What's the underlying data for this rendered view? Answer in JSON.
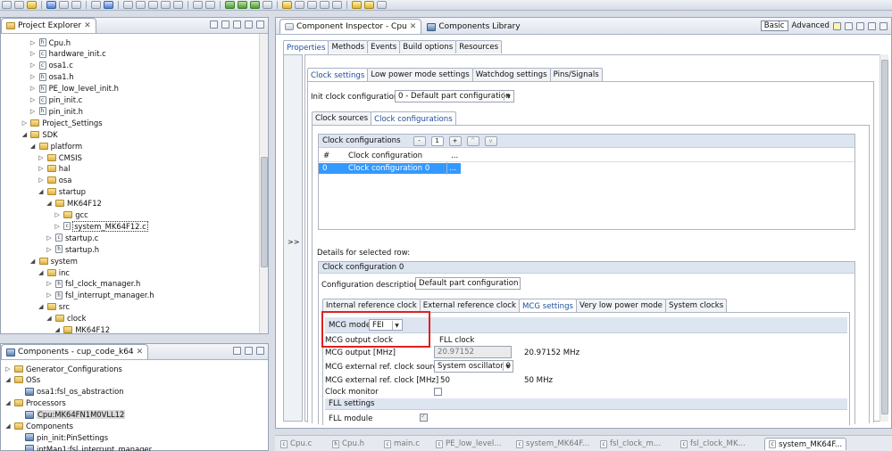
{
  "project_explorer": {
    "title": "Project Explorer",
    "close": "✕",
    "items": [
      {
        "label": "Cpu.h",
        "icon": "h"
      },
      {
        "label": "hardware_init.c",
        "icon": "c"
      },
      {
        "label": "osa1.c",
        "icon": "c"
      },
      {
        "label": "osa1.h",
        "icon": "h"
      },
      {
        "label": "PE_low_level_init.h",
        "icon": "h"
      },
      {
        "label": "pin_init.c",
        "icon": "c"
      },
      {
        "label": "pin_init.h",
        "icon": "h"
      },
      {
        "label": "Project_Settings",
        "icon": "folder"
      },
      {
        "label": "SDK",
        "icon": "folder"
      },
      {
        "label": "platform",
        "icon": "folder"
      },
      {
        "label": "CMSIS",
        "icon": "folder"
      },
      {
        "label": "hal",
        "icon": "folder"
      },
      {
        "label": "osa",
        "icon": "folder"
      },
      {
        "label": "startup",
        "icon": "folder"
      },
      {
        "label": "MK64F12",
        "icon": "folder"
      },
      {
        "label": "gcc",
        "icon": "folder"
      },
      {
        "label": "system_MK64F12.c",
        "icon": "c"
      },
      {
        "label": "startup.c",
        "icon": "c"
      },
      {
        "label": "startup.h",
        "icon": "h"
      },
      {
        "label": "system",
        "icon": "folder"
      },
      {
        "label": "inc",
        "icon": "folder"
      },
      {
        "label": "fsl_clock_manager.h",
        "icon": "h"
      },
      {
        "label": "fsl_interrupt_manager.h",
        "icon": "h"
      },
      {
        "label": "src",
        "icon": "folder"
      },
      {
        "label": "clock",
        "icon": "folder"
      },
      {
        "label": "MK64F12",
        "icon": "folder"
      }
    ]
  },
  "components_view": {
    "title": "Components - cup_code_k64",
    "close": "✕",
    "items": [
      {
        "label": "Generator_Configurations"
      },
      {
        "label": "OSs"
      },
      {
        "label": "osa1:fsl_os_abstraction"
      },
      {
        "label": "Processors"
      },
      {
        "label": "Cpu:MK64FN1M0VLL12"
      },
      {
        "label": "Components"
      },
      {
        "label": "pin_init:PinSettings"
      },
      {
        "label": "intMan1:fsl_interrupt_manager"
      }
    ]
  },
  "inspector": {
    "tab_inspector": "Component Inspector - Cpu",
    "tab_close": "✕",
    "tab_library": "Components Library",
    "mode_basic": "Basic",
    "mode_advanced": "Advanced",
    "collapse_label": ">>",
    "tabs": [
      "Properties",
      "Methods",
      "Events",
      "Build options",
      "Resources"
    ],
    "clock_tabs": [
      "Clock settings",
      "Low power mode settings",
      "Watchdog settings",
      "Pins/Signals"
    ],
    "init_label": "Init clock configuration",
    "init_value": "0 - Default  part configuration",
    "source_tabs": [
      "Clock sources",
      "Clock configurations"
    ],
    "table_title": "Clock configurations",
    "table_minus": "-",
    "table_count": "1",
    "table_plus": "+",
    "table_up": "^",
    "table_down": "v",
    "table_headers": [
      "#",
      "Clock configuration",
      "..."
    ],
    "table_row": {
      "index": "0",
      "name": "Clock configuration 0",
      "more": "..."
    },
    "details_label": "Details for selected row:",
    "details_title": "Clock configuration 0",
    "desc_label": "Configuration description",
    "desc_value": "Default  part configuration",
    "mcg_tabs": [
      "Internal reference clock",
      "External reference clock",
      "MCG settings",
      "Very low power mode",
      "System clocks"
    ],
    "mcg_mode_label": "MCG mode",
    "mcg_mode_value": "FEI",
    "rows": {
      "out_clock_label": "MCG output clock",
      "out_clock_value": "FLL clock",
      "out_mhz_label": "MCG output [MHz]",
      "out_mhz_field": "20.97152",
      "out_mhz_value": "20.97152 MHz",
      "ext_src_label": "MCG external ref. clock source",
      "ext_src_value": "System oscillator 0",
      "ext_mhz_label": "MCG external ref. clock [MHz]",
      "ext_mhz_field": "50",
      "ext_mhz_value": "50 MHz",
      "monitor_label": "Clock monitor",
      "fll_header": "FLL settings",
      "fll_module_label": "FLL module"
    }
  },
  "editor_tabs": [
    "Cpu.c",
    "Cpu.h",
    "main.c",
    "PE_low_level...",
    "system_MK64F...",
    "fsl_clock_m...",
    "fsl_clock_MK...",
    "system_MK64F..."
  ]
}
